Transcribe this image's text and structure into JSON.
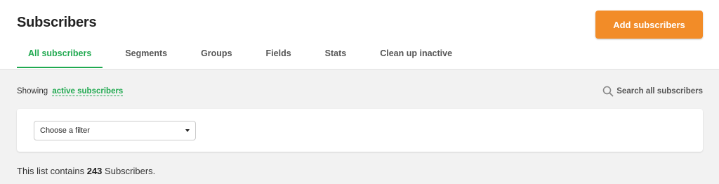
{
  "header": {
    "title": "Subscribers",
    "add_button_label": "Add subscribers",
    "accent_color": "#f28c28"
  },
  "tabs": [
    {
      "label": "All subscribers",
      "active": true
    },
    {
      "label": "Segments",
      "active": false
    },
    {
      "label": "Groups",
      "active": false
    },
    {
      "label": "Fields",
      "active": false
    },
    {
      "label": "Stats",
      "active": false
    },
    {
      "label": "Clean up inactive",
      "active": false
    }
  ],
  "filter_bar": {
    "showing_prefix": "Showing",
    "showing_link": "active subscribers",
    "search_label": "Search all subscribers",
    "search_icon": "search-icon"
  },
  "filter": {
    "selected": "Choose a filter"
  },
  "summary": {
    "prefix": "This list contains",
    "count": "243",
    "suffix": "Subscribers."
  },
  "colors": {
    "active_tab": "#20a950",
    "background": "#f2f2f2"
  }
}
